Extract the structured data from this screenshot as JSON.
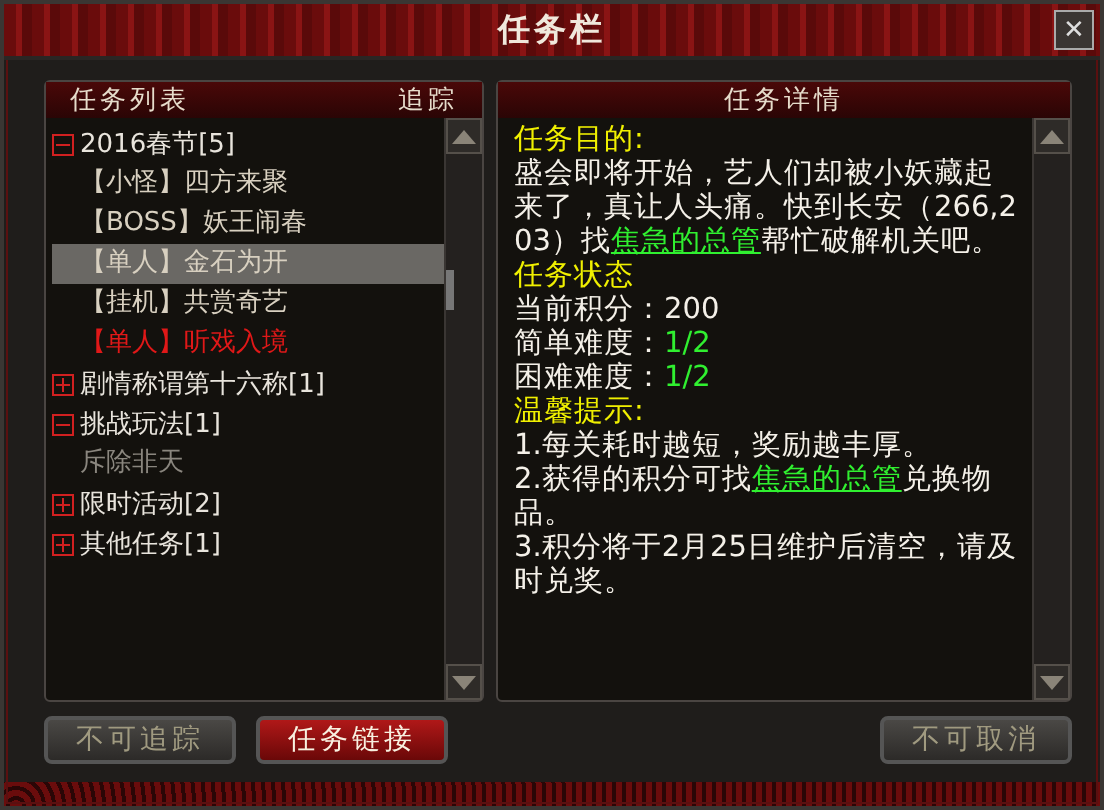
{
  "window": {
    "title": "任务栏",
    "close": "✕"
  },
  "task_list": {
    "header": "任务列表",
    "track_header": "追踪",
    "groups": [
      {
        "label": "2016春节[5]",
        "expanded": true,
        "children": [
          {
            "label": "【小怪】四方来聚",
            "selected": false,
            "color": "#d8d0c0"
          },
          {
            "label": "【BOSS】妖王闹春",
            "selected": false,
            "color": "#d8d0c0"
          },
          {
            "label": "【单人】金石为开",
            "selected": true,
            "color": "#d8d0c0"
          },
          {
            "label": "【挂机】共赏奇艺",
            "selected": false,
            "color": "#d8d0c0"
          },
          {
            "label": "【单人】听戏入境",
            "selected": false,
            "color": "#e01818"
          }
        ]
      },
      {
        "label": "剧情称谓第十六称[1]",
        "expanded": false
      },
      {
        "label": "挑战玩法[1]",
        "expanded": true,
        "children": [
          {
            "label": "斥除非天",
            "selected": false,
            "color": "#8a867e"
          }
        ]
      },
      {
        "label": "限时活动[2]",
        "expanded": false
      },
      {
        "label": "其他任务[1]",
        "expanded": false
      }
    ]
  },
  "task_detail": {
    "header": "任务详情",
    "paragraphs": [
      [
        {
          "kind": "heading",
          "text": "任务目的:"
        }
      ],
      [
        {
          "kind": "plain",
          "text": "盛会即将开始，艺人们却被小妖藏起来了，真让人头痛。快到长安（266,203）找"
        },
        {
          "kind": "link",
          "text": "焦急的总管"
        },
        {
          "kind": "plain",
          "text": "帮忙破解机关吧。"
        }
      ],
      [
        {
          "kind": "heading",
          "text": "任务状态"
        }
      ],
      [
        {
          "kind": "plain",
          "text": "当前积分：200"
        }
      ],
      [
        {
          "kind": "plain",
          "text": "简单难度："
        },
        {
          "kind": "value",
          "text": "1/2"
        }
      ],
      [
        {
          "kind": "plain",
          "text": "困难难度："
        },
        {
          "kind": "value",
          "text": "1/2"
        }
      ],
      [
        {
          "kind": "heading",
          "text": "温馨提示:"
        }
      ],
      [
        {
          "kind": "plain",
          "text": "1.每关耗时越短，奖励越丰厚。"
        }
      ],
      [
        {
          "kind": "plain",
          "text": "2.获得的积分可找"
        },
        {
          "kind": "link",
          "text": "焦急的总管"
        },
        {
          "kind": "plain",
          "text": "兑换物品。"
        }
      ],
      [
        {
          "kind": "plain",
          "text": "3.积分将于2月25日维护后清空，请及时兑奖。"
        }
      ]
    ]
  },
  "buttons": [
    {
      "label": "不可追踪",
      "disabled": true
    },
    {
      "label": "任务链接",
      "disabled": false
    },
    {
      "label": "不可取消",
      "disabled": true
    }
  ]
}
